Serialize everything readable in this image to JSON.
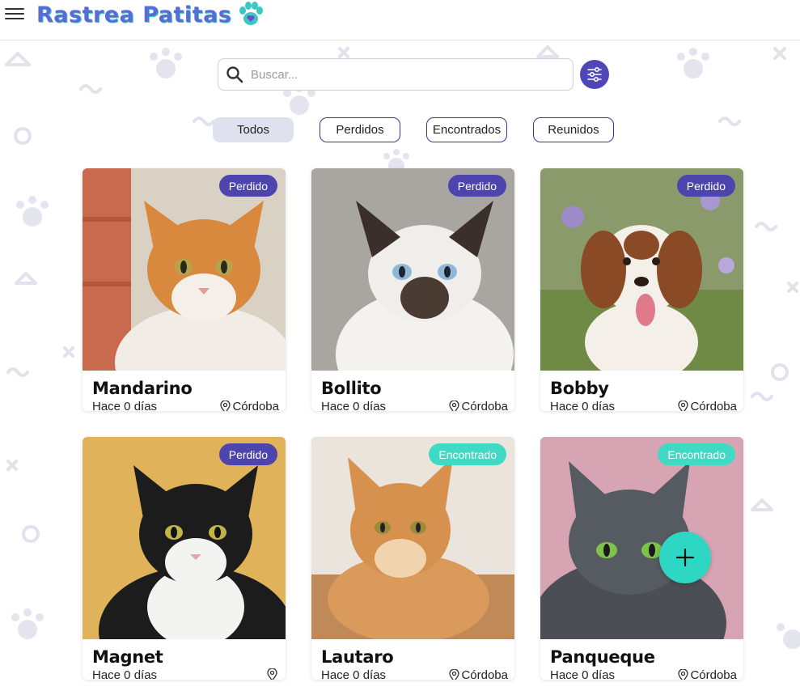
{
  "app": {
    "title": "Rastrea Patitas"
  },
  "search": {
    "placeholder": "Buscar..."
  },
  "tabs": [
    {
      "label": "Todos",
      "active": true
    },
    {
      "label": "Perdidos",
      "active": false
    },
    {
      "label": "Encontrados",
      "active": false
    },
    {
      "label": "Reunidos",
      "active": false
    }
  ],
  "pets": [
    {
      "name": "Mandarino",
      "status": "Perdido",
      "time": "Hace 0 días",
      "location": "Córdoba"
    },
    {
      "name": "Bollito",
      "status": "Perdido",
      "time": "Hace 0 días",
      "location": "Córdoba"
    },
    {
      "name": "Bobby",
      "status": "Perdido",
      "time": "Hace 0 días",
      "location": "Córdoba"
    },
    {
      "name": "Magnet",
      "status": "Perdido",
      "time": "Hace 0 días",
      "location": ""
    },
    {
      "name": "Lautaro",
      "status": "Encontrado",
      "time": "Hace 0 días",
      "location": "Córdoba"
    },
    {
      "name": "Panqueque",
      "status": "Encontrado",
      "time": "Hace 0 días",
      "location": "Córdoba"
    }
  ],
  "colors": {
    "brand": "#5b6bd6",
    "accent": "#4d44ad",
    "found": "#3fd9c4",
    "fab": "#2ed6c4"
  },
  "icons": {
    "menu": "hamburger-icon",
    "search": "search-icon",
    "filter": "sliders-icon",
    "location": "map-pin-icon",
    "add": "plus-icon"
  }
}
